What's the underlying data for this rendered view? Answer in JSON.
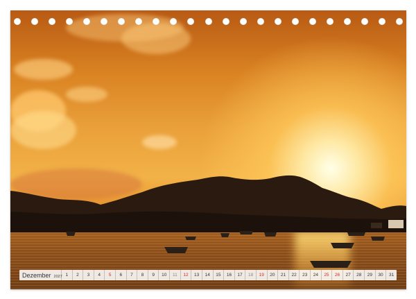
{
  "calendar": {
    "month": "Dezember",
    "year": "2027",
    "days": [
      {
        "n": "1"
      },
      {
        "n": "2"
      },
      {
        "n": "3"
      },
      {
        "n": "4"
      },
      {
        "n": "5",
        "type": "hol"
      },
      {
        "n": "6"
      },
      {
        "n": "7"
      },
      {
        "n": "8"
      },
      {
        "n": "9"
      },
      {
        "n": "10"
      },
      {
        "n": "11",
        "type": "weekend"
      },
      {
        "n": "12",
        "type": "hol"
      },
      {
        "n": "13"
      },
      {
        "n": "14"
      },
      {
        "n": "15"
      },
      {
        "n": "16"
      },
      {
        "n": "17"
      },
      {
        "n": "18",
        "type": "weekend"
      },
      {
        "n": "19",
        "type": "hol"
      },
      {
        "n": "20"
      },
      {
        "n": "21"
      },
      {
        "n": "22"
      },
      {
        "n": "23"
      },
      {
        "n": "24"
      },
      {
        "n": "25",
        "type": "hol"
      },
      {
        "n": "26",
        "type": "hol"
      },
      {
        "n": "27"
      },
      {
        "n": "28"
      },
      {
        "n": "29"
      },
      {
        "n": "30"
      },
      {
        "n": "31"
      }
    ]
  },
  "binding": {
    "hole_count": 23
  },
  "colors": {
    "holiday": "#d12b2b",
    "sun": "#fff4d0",
    "sky_top": "#b85a14"
  },
  "photo": {
    "icon": "sunset-over-bay-photo"
  }
}
